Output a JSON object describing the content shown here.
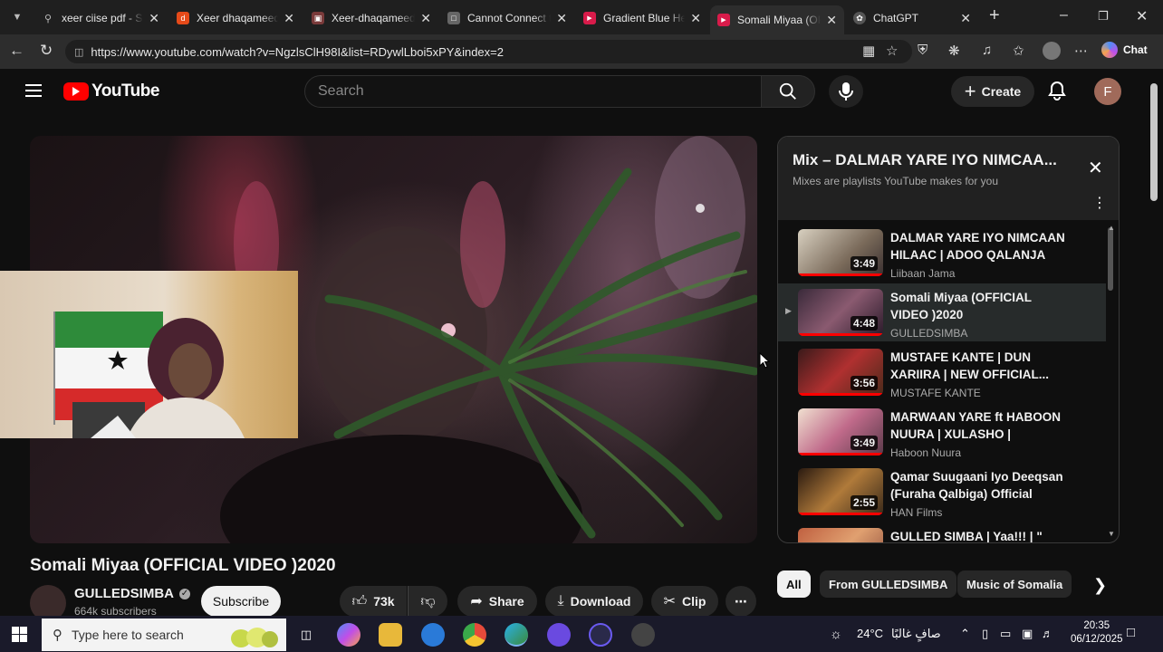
{
  "browser": {
    "tabs": [
      {
        "title": "xeer ciise pdf - Sear",
        "icon": "search-icon",
        "color": "#4a4a4a"
      },
      {
        "title": "Xeer dhaqameed xu",
        "icon": "red-d-icon",
        "color": "#e64a19"
      },
      {
        "title": "Xeer-dhaqameed.pd",
        "icon": "pdf-icon",
        "color": "#8a3a3a"
      },
      {
        "title": "Cannot Connect to",
        "icon": "page-icon",
        "color": "#555555"
      },
      {
        "title": "Gradient Blue Hear",
        "icon": "youtube-icon",
        "color": "#d81b4a"
      },
      {
        "title": "Somali Miyaa (OFFI",
        "icon": "youtube-icon",
        "color": "#d81b4a"
      },
      {
        "title": "ChatGPT",
        "icon": "chatgpt-icon",
        "color": "#666666"
      }
    ],
    "url": "https://www.youtube.com/watch?v=NgzlsClH98I&list=RDywlLboi5xPY&index=2",
    "chat_label": "Chat"
  },
  "youtube": {
    "logo_text": "YouTube",
    "search_placeholder": "Search",
    "create_label": "Create",
    "avatar_letter": "F"
  },
  "video": {
    "title": "Somali Miyaa (OFFICIAL VIDEO )2020",
    "channel": "GULLEDSIMBA",
    "subscribers": "664k subscribers",
    "subscribe_label": "Subscribe",
    "likes": "73k",
    "share_label": "Share",
    "download_label": "Download",
    "clip_label": "Clip"
  },
  "playlist": {
    "title": "Mix – DALMAR YARE IYO NIMCAA...",
    "subtitle": "Mixes are playlists YouTube makes for you",
    "items": [
      {
        "title": "DALMAR YARE IYO NIMCAAN HILAAC | ADOO QALANJA AH...",
        "channel": "Liibaan Jama",
        "duration": "3:49",
        "active": false
      },
      {
        "title": "Somali Miyaa (OFFICIAL VIDEO )2020",
        "channel": "GULLEDSIMBA",
        "duration": "4:48",
        "active": true
      },
      {
        "title": "MUSTAFE KANTE | DUN XARIIRA | NEW OFFICIAL...",
        "channel": "MUSTAFE KANTE",
        "duration": "3:56",
        "active": false
      },
      {
        "title": "MARWAAN YARE ft HABOON NUURA | XULASHO | OFFICIA...",
        "channel": "Haboon Nuura",
        "duration": "3:49",
        "active": false
      },
      {
        "title": "Qamar Suugaani Iyo Deeqsan (Furaha Qalbiga) Official Musi...",
        "channel": "HAN Films",
        "duration": "2:55",
        "active": false
      },
      {
        "title": "GULLED SIMBA | Yaa!!! | \"",
        "channel": "",
        "duration": "",
        "active": false
      }
    ]
  },
  "chips": [
    "All",
    "From GULLEDSIMBA",
    "Music of Somalia"
  ],
  "taskbar": {
    "search_placeholder": "Type here to search",
    "weather": "24°C",
    "weather_desc": "صافٍ غالبًا",
    "time": "20:35",
    "date": "06/12/2025"
  },
  "colors": {
    "accent": "#ff0000",
    "background": "#0f0f0f"
  }
}
